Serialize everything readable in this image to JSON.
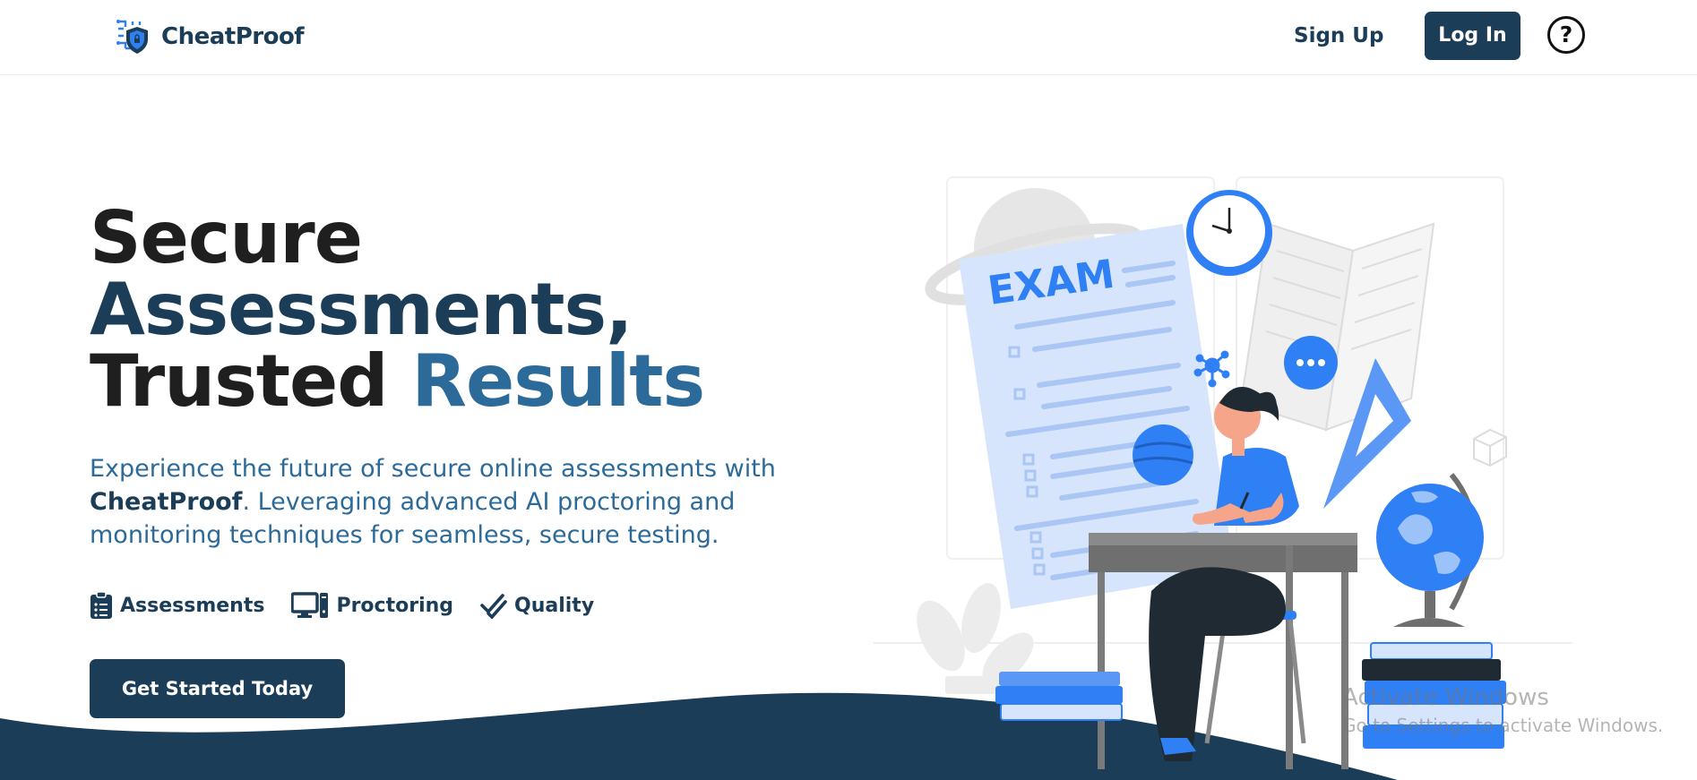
{
  "brand": {
    "name": "CheatProof",
    "logo_icon": "shield-circuit-icon"
  },
  "nav": {
    "signup": "Sign Up",
    "login": "Log In",
    "help_icon": "?"
  },
  "hero": {
    "title_line1": "Secure",
    "title_line2": "Assessments,",
    "title_line3_a": "Trusted ",
    "title_line3_b": "Results",
    "desc_a": "Experience the future of secure online assessments with ",
    "desc_brand": "CheatProof",
    "desc_b": ". Leveraging advanced AI proctoring and monitoring techniques for seamless, secure testing.",
    "features": [
      {
        "label": "Assessments",
        "icon": "clipboard-icon"
      },
      {
        "label": "Proctoring",
        "icon": "monitor-icon"
      },
      {
        "label": "Quality",
        "icon": "double-check-icon"
      }
    ],
    "cta": "Get Started Today"
  },
  "illustration": {
    "exam_label": "EXAM"
  },
  "watermark": {
    "title": "Activate Windows",
    "subtitle": "Go to Settings to activate Windows."
  },
  "colors": {
    "navy": "#1b3d57",
    "steel": "#2b6a99",
    "accent_blue": "#2f7ff5",
    "paper": "#d6e5fc"
  }
}
